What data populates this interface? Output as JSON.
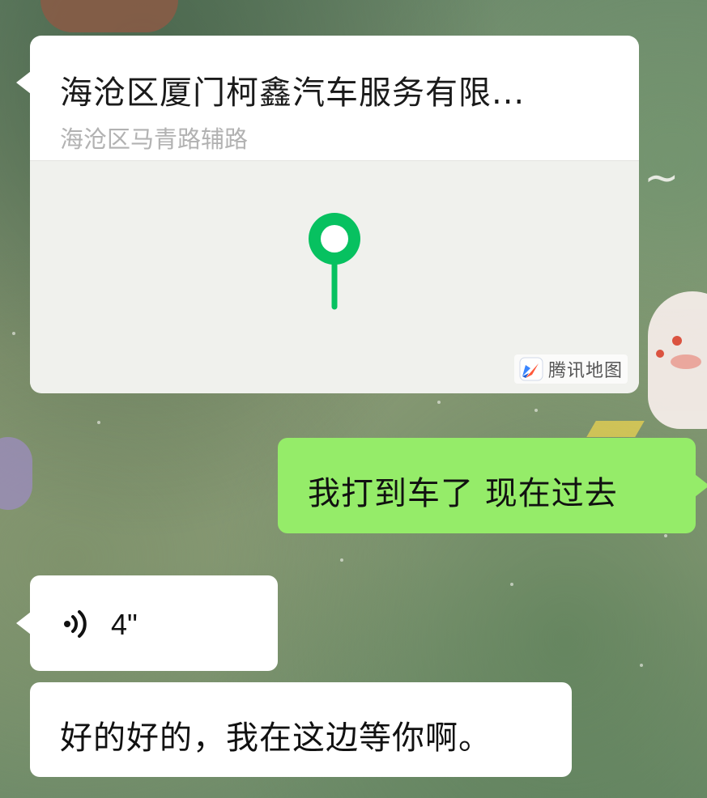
{
  "location_message": {
    "title": "海沧区厦门柯鑫汽车服务有限...",
    "address": "海沧区马青路辅路",
    "map_brand": "腾讯地图",
    "map_brand_icon": "tencent-map-logo",
    "pin_icon": "location-pin",
    "pin_color": "#07c160"
  },
  "outgoing_message": {
    "text": "我打到车了 现在过去",
    "bubble_color": "#95ec69"
  },
  "voice_message": {
    "icon": "voice-wave",
    "duration": "4\""
  },
  "incoming_message": {
    "text": "好的好的，我在这边等你啊。"
  }
}
